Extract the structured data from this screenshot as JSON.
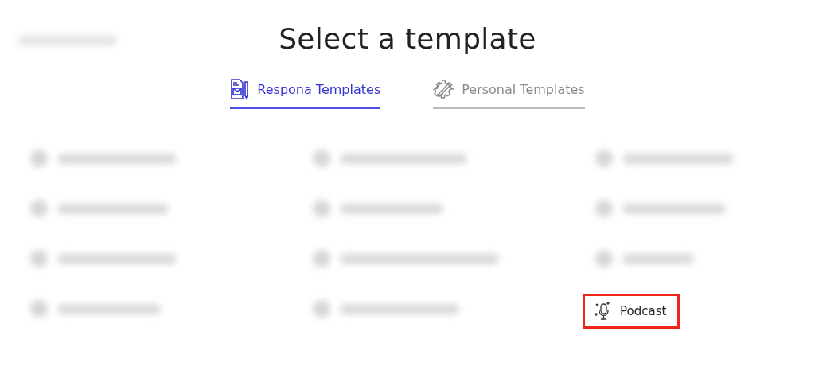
{
  "title": "Select a template",
  "tabs": [
    {
      "label": "Respona Templates",
      "selected": true,
      "kind": "document"
    },
    {
      "label": "Personal Templates",
      "selected": false,
      "kind": "gear"
    }
  ],
  "templates": [
    {
      "kind": "blurred"
    },
    {
      "kind": "blurred"
    },
    {
      "kind": "blurred"
    },
    {
      "kind": "blurred"
    },
    {
      "kind": "blurred"
    },
    {
      "kind": "blurred"
    },
    {
      "kind": "blurred"
    },
    {
      "kind": "blurred"
    },
    {
      "kind": "blurred"
    },
    {
      "kind": "blurred"
    },
    {
      "kind": "blurred"
    },
    {
      "kind": "template",
      "label": "Podcast",
      "highlighted": true
    }
  ]
}
